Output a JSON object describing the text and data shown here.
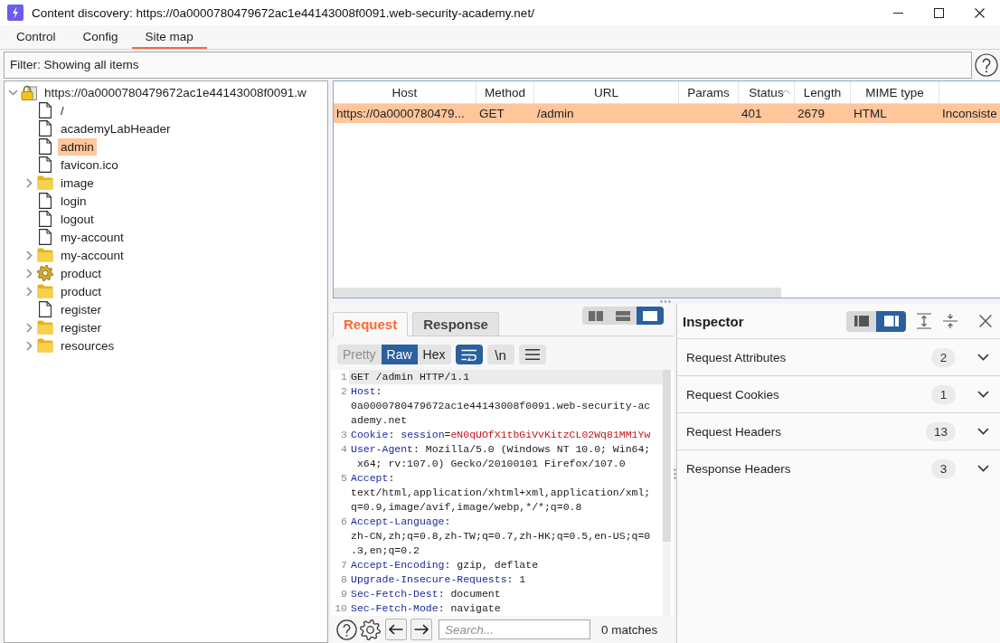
{
  "window": {
    "title": "Content discovery: https://0a0000780479672ac1e44143008f0091.web-security-academy.net/"
  },
  "tabs": [
    {
      "label": "Control",
      "selected": false
    },
    {
      "label": "Config",
      "selected": false
    },
    {
      "label": "Site map",
      "selected": true
    }
  ],
  "filter": {
    "text": "Filter: Showing all items"
  },
  "site_map": {
    "tree": [
      {
        "label": "https://0a0000780479672ac1e44143008f0091.w",
        "kind": "secure_host",
        "expanded": true,
        "selected": false,
        "children": [
          {
            "label": "/",
            "kind": "file",
            "selected": false
          },
          {
            "label": "academyLabHeader",
            "kind": "file",
            "selected": false
          },
          {
            "label": "admin",
            "kind": "file",
            "selected": true
          },
          {
            "label": "favicon.ico",
            "kind": "file",
            "selected": false
          },
          {
            "label": "image",
            "kind": "folder",
            "expanded": false,
            "selected": false
          },
          {
            "label": "login",
            "kind": "file",
            "selected": false
          },
          {
            "label": "logout",
            "kind": "file",
            "selected": false
          },
          {
            "label": "my-account",
            "kind": "file",
            "selected": false
          },
          {
            "label": "my-account",
            "kind": "folder",
            "expanded": false,
            "selected": false
          },
          {
            "label": "product",
            "kind": "dynamic",
            "expanded": false,
            "selected": false
          },
          {
            "label": "product",
            "kind": "folder",
            "expanded": false,
            "selected": false
          },
          {
            "label": "register",
            "kind": "file",
            "selected": false
          },
          {
            "label": "register",
            "kind": "folder",
            "expanded": false,
            "selected": false
          },
          {
            "label": "resources",
            "kind": "folder",
            "expanded": false,
            "selected": false
          }
        ]
      }
    ]
  },
  "table": {
    "columns": [
      {
        "label": "Host",
        "sorted": false
      },
      {
        "label": "Method",
        "sorted": false
      },
      {
        "label": "URL",
        "sorted": false
      },
      {
        "label": "Params",
        "sorted": false
      },
      {
        "label": "Status",
        "sorted": true
      },
      {
        "label": "Length",
        "sorted": false
      },
      {
        "label": "MIME type",
        "sorted": false
      }
    ],
    "rows": [
      {
        "selected": true,
        "host": "https://0a0000780479...",
        "method": "GET",
        "url": "/admin",
        "status": "401",
        "length": "2679",
        "mime_type": "HTML",
        "column_8": "Inconsiste"
      }
    ]
  },
  "message_editor": {
    "tabs": [
      {
        "label": "Request",
        "selected": true
      },
      {
        "label": "Response",
        "selected": false
      }
    ],
    "layout_buttons": [
      {
        "kind": "columns",
        "selected": false
      },
      {
        "kind": "rows",
        "selected": false
      },
      {
        "kind": "single",
        "selected": true
      }
    ],
    "format_tabs": [
      {
        "label": "Pretty",
        "selected": false,
        "disabled": true
      },
      {
        "label": "Raw",
        "selected": true,
        "disabled": false
      },
      {
        "label": "Hex",
        "selected": false,
        "disabled": false
      }
    ],
    "toggles": [
      {
        "kind": "wrap",
        "on": true
      },
      {
        "kind": "newlines",
        "label": "\\n",
        "on": false
      }
    ],
    "lines": [
      {
        "number": "1",
        "current": true,
        "segments": [
          {
            "kind": "plain",
            "text": "GET /admin HTTP/1.1"
          }
        ]
      },
      {
        "number": "2",
        "current": false,
        "segments": [
          {
            "kind": "name",
            "text": "Host"
          },
          {
            "kind": "plain",
            "text": ":\n0a0000780479672ac1e44143008f0091.web-security-ac\nademy.net"
          }
        ]
      },
      {
        "number": "3",
        "current": false,
        "segments": [
          {
            "kind": "name",
            "text": "Cookie"
          },
          {
            "kind": "plain",
            "text": ": "
          },
          {
            "kind": "name",
            "text": "session"
          },
          {
            "kind": "plain",
            "text": "="
          },
          {
            "kind": "value",
            "text": "eN0qUOfX1tbGiVvKitzCL02Wq81MM1Yw"
          }
        ]
      },
      {
        "number": "4",
        "current": false,
        "segments": [
          {
            "kind": "name",
            "text": "User-Agent"
          },
          {
            "kind": "plain",
            "text": ": Mozilla/5.0 (Windows NT 10.0; Win64;\n x64; rv:107.0) Gecko/20100101 Firefox/107.0"
          }
        ]
      },
      {
        "number": "5",
        "current": false,
        "segments": [
          {
            "kind": "name",
            "text": "Accept"
          },
          {
            "kind": "plain",
            "text": ":\ntext/html,application/xhtml+xml,application/xml;\nq=0.9,image/avif,image/webp,*/*;q=0.8"
          }
        ]
      },
      {
        "number": "6",
        "current": false,
        "segments": [
          {
            "kind": "name",
            "text": "Accept-Language"
          },
          {
            "kind": "plain",
            "text": ":\nzh-CN,zh;q=0.8,zh-TW;q=0.7,zh-HK;q=0.5,en-US;q=0\n.3,en;q=0.2"
          }
        ]
      },
      {
        "number": "7",
        "current": false,
        "segments": [
          {
            "kind": "name",
            "text": "Accept-Encoding"
          },
          {
            "kind": "plain",
            "text": ": gzip, deflate"
          }
        ]
      },
      {
        "number": "8",
        "current": false,
        "segments": [
          {
            "kind": "name",
            "text": "Upgrade-Insecure-Requests"
          },
          {
            "kind": "plain",
            "text": ": 1"
          }
        ]
      },
      {
        "number": "9",
        "current": false,
        "segments": [
          {
            "kind": "name",
            "text": "Sec-Fetch-Dest"
          },
          {
            "kind": "plain",
            "text": ": document"
          }
        ]
      },
      {
        "number": "10",
        "current": false,
        "segments": [
          {
            "kind": "name",
            "text": "Sec-Fetch-Mode"
          },
          {
            "kind": "plain",
            "text": ": navigate"
          }
        ]
      }
    ],
    "search": {
      "placeholder": "Search..."
    },
    "matches": "0 matches"
  },
  "inspector": {
    "title": "Inspector",
    "layout_buttons": [
      {
        "kind": "sidebar",
        "selected": false
      },
      {
        "kind": "panel",
        "selected": true
      }
    ],
    "sections": [
      {
        "label": "Request Attributes",
        "count": "2",
        "expanded": false
      },
      {
        "label": "Request Cookies",
        "count": "1",
        "expanded": false
      },
      {
        "label": "Request Headers",
        "count": "13",
        "expanded": false
      },
      {
        "label": "Response Headers",
        "count": "3",
        "expanded": false
      }
    ]
  }
}
